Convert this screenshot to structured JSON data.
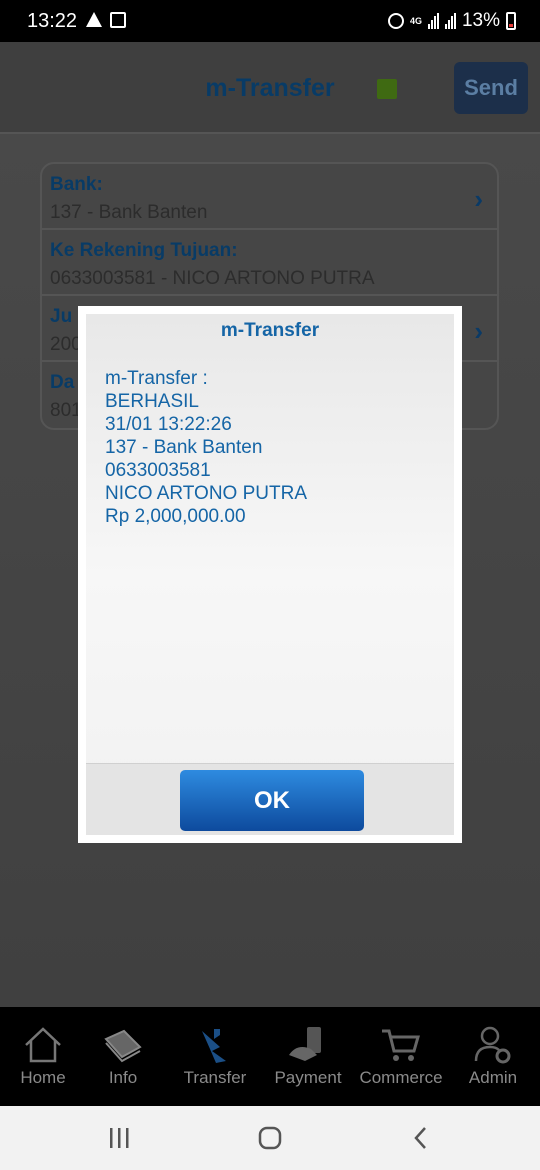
{
  "status_bar": {
    "time": "13:22",
    "network": "4G",
    "battery": "13%",
    "icons": [
      "warning-icon",
      "wifi-icon",
      "alarm-icon",
      "signal-icon",
      "battery-icon"
    ]
  },
  "header": {
    "title": "m-Transfer",
    "send_label": "Send",
    "status_color": "#3f6a12"
  },
  "form": {
    "rows": [
      {
        "label": "Bank:",
        "value": "137 - Bank Banten",
        "has_chevron": true
      },
      {
        "label": "Ke Rekening Tujuan:",
        "value": "0633003581 - NICO ARTONO PUTRA",
        "has_chevron": false
      },
      {
        "label": "Ju",
        "value": "200",
        "has_chevron": true
      },
      {
        "label": "Da",
        "value": "801",
        "has_chevron": false
      }
    ]
  },
  "dialog": {
    "title": "m-Transfer",
    "lines": [
      "m-Transfer :",
      "BERHASIL",
      "31/01 13:22:26",
      "137 - Bank Banten",
      "0633003581",
      "NICO ARTONO PUTRA",
      "Rp 2,000,000.00"
    ],
    "ok_label": "OK"
  },
  "bottom_nav": [
    {
      "label": "Home",
      "icon": "home-icon"
    },
    {
      "label": "Info",
      "icon": "book-icon"
    },
    {
      "label": "Transfer",
      "icon": "transfer-icon"
    },
    {
      "label": "Payment",
      "icon": "payment-icon"
    },
    {
      "label": "Commerce",
      "icon": "cart-icon"
    },
    {
      "label": "Admin",
      "icon": "admin-icon"
    }
  ],
  "colors": {
    "accent": "#1565a6",
    "ok_button_top": "#2e8be0",
    "ok_button_bottom": "#0d4a9d",
    "header_title": "#083b66"
  }
}
